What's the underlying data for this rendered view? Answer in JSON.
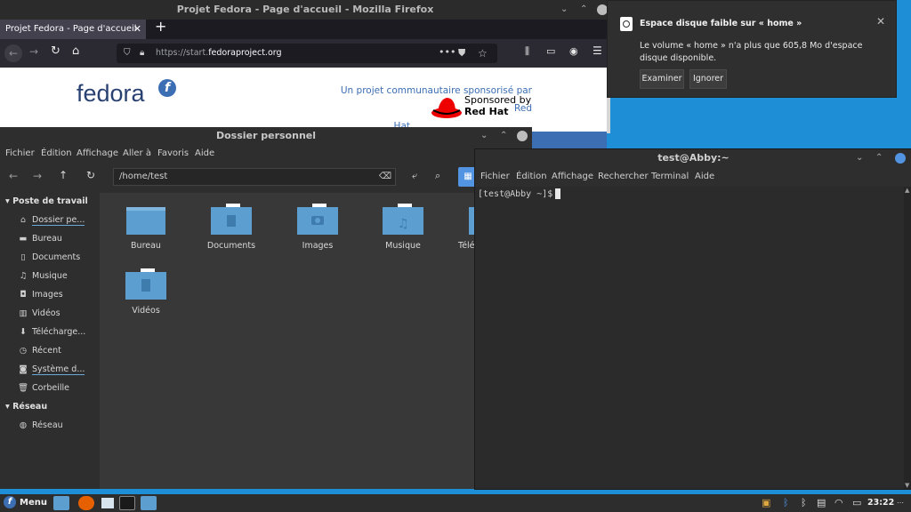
{
  "firefox": {
    "window_title": "Projet Fedora - Page d'accueil - Mozilla Firefox",
    "tab_label": "Projet Fedora - Page d'accueil",
    "url_prefix": "https://start.",
    "url_domain": "fedoraproject.org",
    "page": {
      "logo_text": "fedora",
      "sponsor_line1": "Un projet communautaire sponsorisé par Red",
      "sponsor_line2": "Hat",
      "sponsored_by": "Sponsored by",
      "red_hat": "Red Hat"
    }
  },
  "notification": {
    "title": "Espace disque faible sur « home »",
    "body": "Le volume « home » n'a plus que 605,8 Mo d'espace disque disponible.",
    "btn_examine": "Examiner",
    "btn_ignore": "Ignorer"
  },
  "file_manager": {
    "window_title": "Dossier personnel",
    "menu": [
      "Fichier",
      "Édition",
      "Affichage",
      "Aller à",
      "Favoris",
      "Aide"
    ],
    "path": "/home/test",
    "sidebar": {
      "section1": "Poste de travail",
      "items": [
        "Dossier pe...",
        "Bureau",
        "Documents",
        "Musique",
        "Images",
        "Vidéos",
        "Télécharge...",
        "Récent",
        "Système d...",
        "Corbeille"
      ],
      "section2": "Réseau",
      "network_items": [
        "Réseau"
      ]
    },
    "folders": [
      "Bureau",
      "Documents",
      "Images",
      "Musique",
      "Téléc",
      "Vidéos"
    ]
  },
  "terminal": {
    "window_title": "test@Abby:~",
    "menu": [
      "Fichier",
      "Édition",
      "Affichage",
      "Rechercher",
      "Terminal",
      "Aide"
    ],
    "prompt": "[test@Abby ~]$"
  },
  "taskbar": {
    "menu_label": "Menu",
    "clock": "23:22"
  },
  "colors": {
    "desktop": "#1e8fd6",
    "folder": "#5b9ecf",
    "redhat": "#ee0000"
  }
}
